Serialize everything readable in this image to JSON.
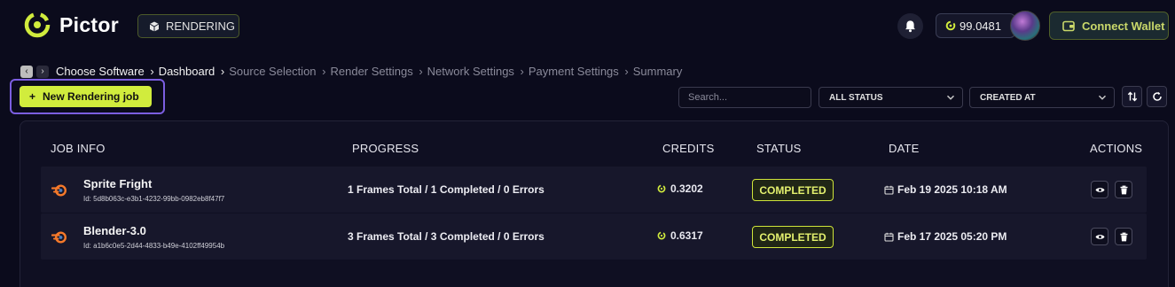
{
  "header": {
    "logo_text": "Pictor",
    "mode_badge": "RENDERING",
    "credits_balance": "99.0481",
    "wallet_button": "Connect Wallet"
  },
  "breadcrumb": [
    {
      "label": "Choose Software",
      "state": "active"
    },
    {
      "label": "Dashboard",
      "state": "active"
    },
    {
      "label": "Source Selection",
      "state": "inactive"
    },
    {
      "label": "Render Settings",
      "state": "inactive"
    },
    {
      "label": "Network Settings",
      "state": "inactive"
    },
    {
      "label": "Payment Settings",
      "state": "inactive"
    },
    {
      "label": "Summary",
      "state": "inactive"
    }
  ],
  "toolbar": {
    "new_job_label": "New Rendering job",
    "search_placeholder": "Search...",
    "status_filter": "ALL STATUS",
    "sort_by": "CREATED AT"
  },
  "table": {
    "headers": {
      "job_info": "JOB INFO",
      "progress": "PROGRESS",
      "credits": "CREDITS",
      "status": "STATUS",
      "date": "DATE",
      "actions": "ACTIONS"
    },
    "rows": [
      {
        "name": "Sprite Fright",
        "id": "Id: 5d8b063c-e3b1-4232-99bb-0982eb8f47f7",
        "progress": "1 Frames Total / 1 Completed / 0 Errors",
        "credits": "0.3202",
        "status": "COMPLETED",
        "date": "Feb 19 2025 10:18 AM"
      },
      {
        "name": "Blender-3.0",
        "id": "Id: a1b6c0e5-2d44-4833-b49e-4102ff49954b",
        "progress": "3 Frames Total / 3 Completed / 0 Errors",
        "credits": "0.6317",
        "status": "COMPLETED",
        "date": "Feb 17 2025 05:20 PM"
      }
    ]
  },
  "colors": {
    "background": "#0b0b1c",
    "accent": "#d1ec3d",
    "highlight_border": "#7b5ee0",
    "blender_orange": "#f5792a"
  }
}
